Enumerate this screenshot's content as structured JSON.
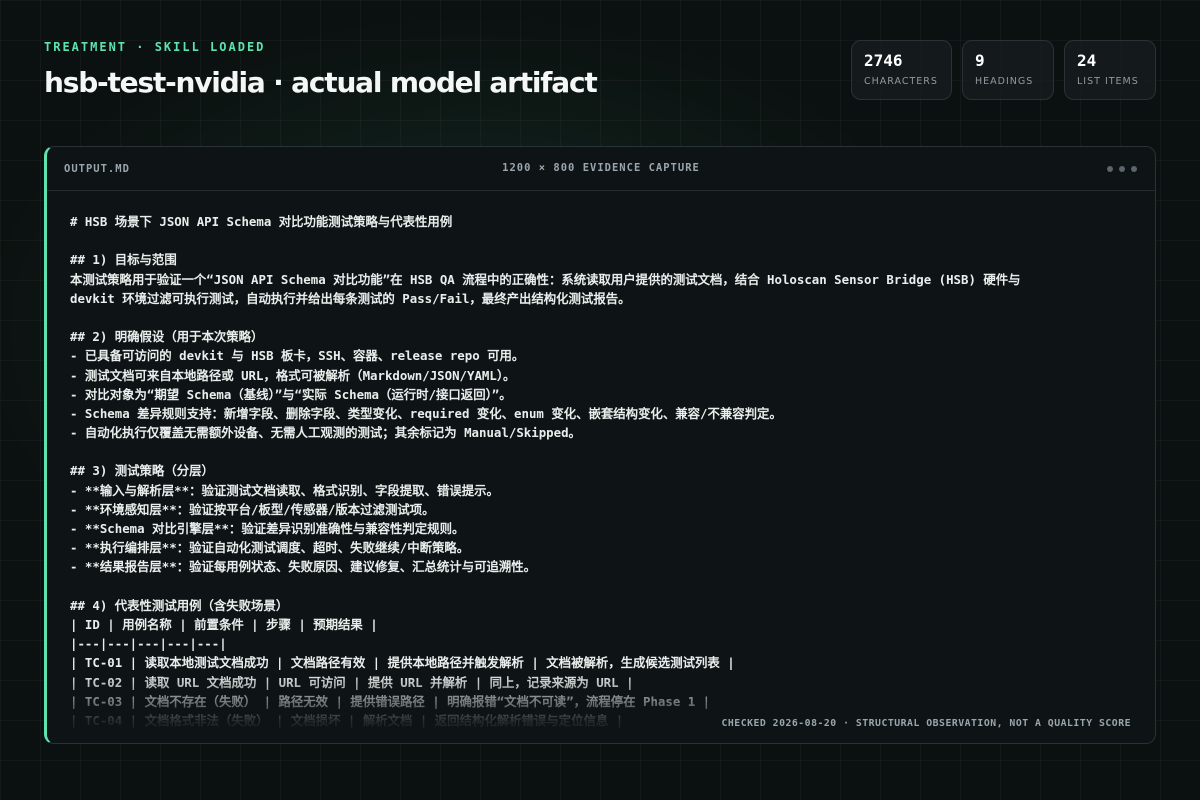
{
  "header": {
    "eyebrow": "TREATMENT · SKILL LOADED",
    "title": "hsb-test-nvidia · actual model artifact"
  },
  "stats": [
    {
      "value": "2746",
      "label": "CHARACTERS"
    },
    {
      "value": "9",
      "label": "HEADINGS"
    },
    {
      "value": "24",
      "label": "LIST ITEMS"
    }
  ],
  "panel": {
    "filename": "OUTPUT.MD",
    "capture": "1200 × 800 EVIDENCE CAPTURE",
    "footnote": "CHECKED 2026-08-20 · STRUCTURAL OBSERVATION, NOT A QUALITY SCORE",
    "lines": [
      "# HSB 场景下 JSON API Schema 对比功能测试策略与代表性用例",
      "",
      "## 1) 目标与范围",
      "本测试策略用于验证一个“JSON API Schema 对比功能”在 HSB QA 流程中的正确性：系统读取用户提供的测试文档，结合 Holoscan Sensor Bridge (HSB) 硬件与",
      "devkit 环境过滤可执行测试，自动执行并给出每条测试的 Pass/Fail，最终产出结构化测试报告。",
      "",
      "## 2) 明确假设（用于本次策略）",
      "- 已具备可访问的 devkit 与 HSB 板卡，SSH、容器、release repo 可用。",
      "- 测试文档可来自本地路径或 URL，格式可被解析（Markdown/JSON/YAML）。",
      "- 对比对象为“期望 Schema（基线）”与“实际 Schema（运行时/接口返回）”。",
      "- Schema 差异规则支持：新增字段、删除字段、类型变化、required 变化、enum 变化、嵌套结构变化、兼容/不兼容判定。",
      "- 自动化执行仅覆盖无需额外设备、无需人工观测的测试；其余标记为 Manual/Skipped。",
      "",
      "## 3) 测试策略（分层）",
      "- **输入与解析层**：验证测试文档读取、格式识别、字段提取、错误提示。",
      "- **环境感知层**：验证按平台/板型/传感器/版本过滤测试项。",
      "- **Schema 对比引擎层**：验证差异识别准确性与兼容性判定规则。",
      "- **执行编排层**：验证自动化测试调度、超时、失败继续/中断策略。",
      "- **结果报告层**：验证每用例状态、失败原因、建议修复、汇总统计与可追溯性。",
      "",
      "## 4) 代表性测试用例（含失败场景）",
      "| ID | 用例名称 | 前置条件 | 步骤 | 预期结果 |",
      "|---|---|---|---|---|",
      "| TC-01 | 读取本地测试文档成功 | 文档路径有效 | 提供本地路径并触发解析 | 文档被解析，生成候选测试列表 |",
      "| TC-02 | 读取 URL 文档成功 | URL 可访问 | 提供 URL 并解析 | 同上，记录来源为 URL |",
      "| TC-03 | 文档不存在（失败） | 路径无效 | 提供错误路径 | 明确报错“文档不可读”，流程停在 Phase 1 |",
      "| TC-04 | 文档格式非法（失败） | 文档损坏 | 解析文档 | 返回结构化解析错误与定位信息 |"
    ]
  }
}
